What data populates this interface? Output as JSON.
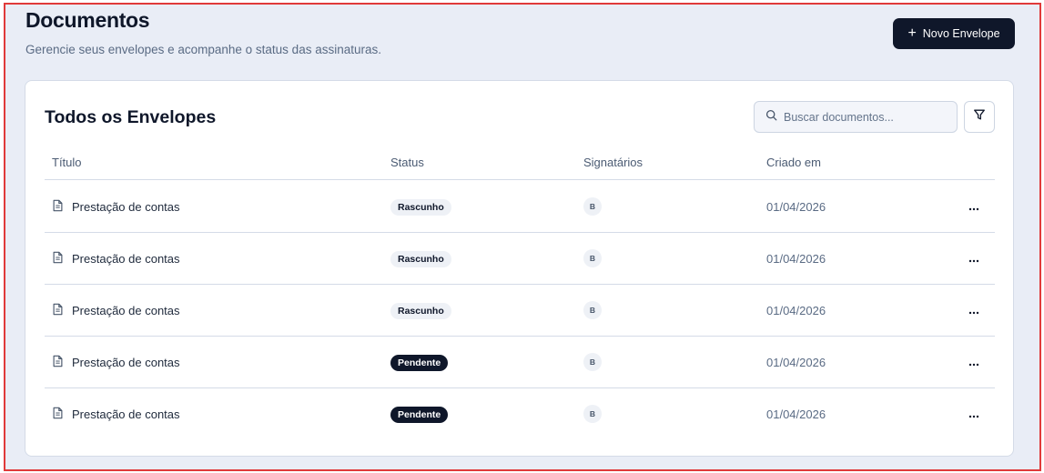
{
  "header": {
    "title": "Documentos",
    "subtitle": "Gerencie seus envelopes e acompanhe o status das assinaturas.",
    "new_button_label": "Novo Envelope",
    "new_button_icon": "plus-icon"
  },
  "card": {
    "title": "Todos os Envelopes",
    "search_placeholder": "Buscar documentos...",
    "search_icon": "search-icon",
    "filter_icon": "filter-icon"
  },
  "table": {
    "columns": [
      "Título",
      "Status",
      "Signatários",
      "Criado em"
    ],
    "rows": [
      {
        "title": "Prestação de contas",
        "status": "Rascunho",
        "status_style": "light",
        "signer": "B",
        "created": "01/04/2026"
      },
      {
        "title": "Prestação de contas",
        "status": "Rascunho",
        "status_style": "light",
        "signer": "B",
        "created": "01/04/2026"
      },
      {
        "title": "Prestação de contas",
        "status": "Rascunho",
        "status_style": "light",
        "signer": "B",
        "created": "01/04/2026"
      },
      {
        "title": "Prestação de contas",
        "status": "Pendente",
        "status_style": "dark",
        "signer": "B",
        "created": "01/04/2026"
      },
      {
        "title": "Prestação de contas",
        "status": "Pendente",
        "status_style": "dark",
        "signer": "B",
        "created": "01/04/2026"
      }
    ],
    "row_menu_icon": "more-horizontal-icon",
    "row_doc_icon": "document-icon"
  },
  "colors": {
    "frame_border": "#e03a3a",
    "background": "#e9edf6",
    "primary": "#0f172a",
    "muted_text": "#5a6b84"
  }
}
